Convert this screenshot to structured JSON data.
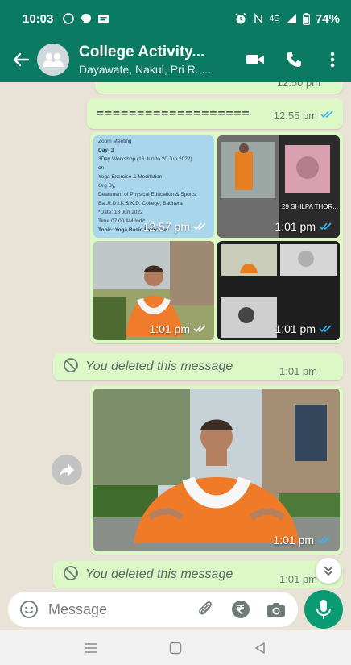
{
  "status_bar": {
    "time": "10:03",
    "network": "4G",
    "battery": "74%",
    "icons": [
      "whatsapp-icon",
      "chat-icon",
      "message-icon",
      "alarm-icon",
      "nfc-icon",
      "signal-icon",
      "battery-icon"
    ]
  },
  "header": {
    "title": "College Activity...",
    "subtitle": "Dayawate, Nakul, Pri R.,...",
    "icons": [
      "back-arrow-icon",
      "group-avatar-icon",
      "video-call-icon",
      "voice-call-icon",
      "more-options-icon"
    ]
  },
  "messages": [
    {
      "type": "text",
      "text": "",
      "time": "12:50 pm",
      "partial": true
    },
    {
      "type": "text",
      "text": "===================",
      "time": "12:55 pm",
      "read": true
    },
    {
      "type": "album",
      "items": [
        {
          "kind": "document-image",
          "time": "12:57 pm",
          "lines": [
            "Zoom Meeting",
            "Day- 3",
            "3Day Workshop (16 Jun to 20 Jun 2022)",
            "on",
            "Yoga Exercise & Meditation",
            "Org By,",
            "Deartment of Physical Education & Sports,",
            "Bai.R.D.I.K.& K.D. College, Badnera",
            "*Date: 18 Jun 2022",
            "Time 07:00 AM Indi*",
            "Topic: Yoga Basic Exercises"
          ]
        },
        {
          "kind": "video-call-screenshot",
          "time": "1:01 pm",
          "caption": "29 SHILPA THOR..."
        },
        {
          "kind": "photo",
          "time": "1:01 pm"
        },
        {
          "kind": "video-call-screenshot",
          "time": "1:01 pm"
        }
      ]
    },
    {
      "type": "deleted",
      "text": "You deleted this message",
      "time": "1:01 pm"
    },
    {
      "type": "photo",
      "time": "1:01 pm"
    },
    {
      "type": "deleted",
      "text": "You deleted this message",
      "time": "1:01 pm"
    }
  ],
  "composer": {
    "placeholder": "Message",
    "icons": [
      "emoji-icon",
      "attach-icon",
      "rupee-payment-icon",
      "camera-icon",
      "mic-icon"
    ]
  },
  "colors": {
    "header": "#0b7a62",
    "bubble": "#dcf8c6",
    "chat_bg": "#e9e2d6",
    "read_tick": "#34b7f1",
    "mic_button": "#0b9b73"
  }
}
